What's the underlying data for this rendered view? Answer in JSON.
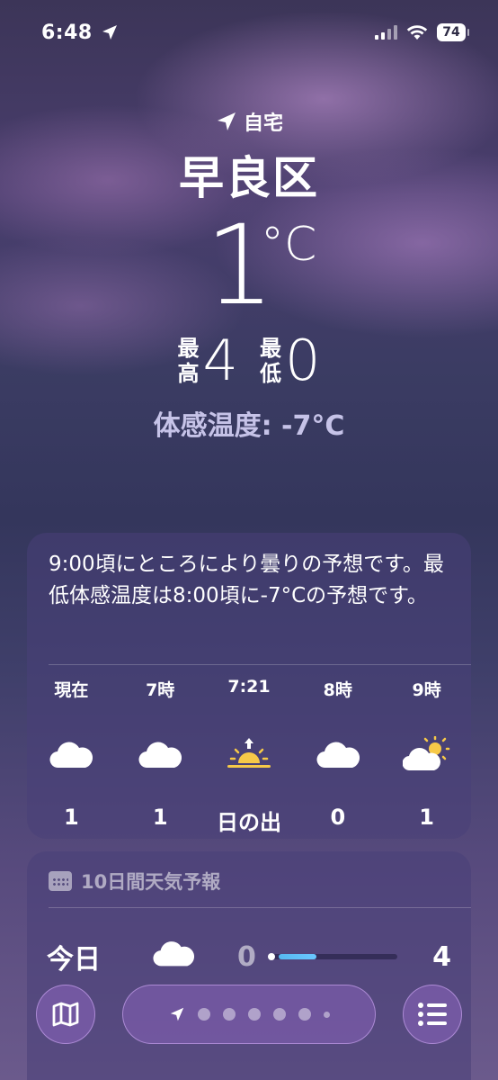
{
  "status_bar": {
    "time": "6:48",
    "battery": "74",
    "icons": [
      "location-arrow-icon",
      "cellular-signal-icon",
      "wifi-icon",
      "battery-icon"
    ]
  },
  "header": {
    "location_label": "自宅",
    "city": "早良区",
    "temperature": "1",
    "unit": "°C",
    "high_label_1": "最",
    "high_label_2": "高",
    "high": "4",
    "low_label_1": "最",
    "low_label_2": "低",
    "low": "0",
    "feels_like": "体感温度: -7°C"
  },
  "hourly": {
    "summary": "9:00頃にところにより曇りの予想です。最低体感温度は8:00頃に-7°Cの予想です。",
    "items": [
      {
        "label": "現在",
        "icon": "cloud-icon",
        "value": "1"
      },
      {
        "label": "7時",
        "icon": "cloud-icon",
        "value": "1"
      },
      {
        "label": "7:21",
        "icon": "sunrise-icon",
        "value": "日の出"
      },
      {
        "label": "8時",
        "icon": "cloud-icon",
        "value": "0"
      },
      {
        "label": "9時",
        "icon": "partly-sunny-icon",
        "value": "1"
      }
    ]
  },
  "daily": {
    "title": "10日間天気予報",
    "rows": [
      {
        "day": "今日",
        "icon": "cloud-icon",
        "low": "0",
        "high": "4",
        "range_fill": 0.3
      }
    ]
  },
  "toolbar": {
    "left_icon": "map-icon",
    "right_icon": "list-icon",
    "page_count": 7,
    "current_page": 0
  },
  "colors": {
    "accent_bar": "#56b8f0",
    "feels_like_text": "#c6c3e8",
    "sun": "#f7c948"
  }
}
